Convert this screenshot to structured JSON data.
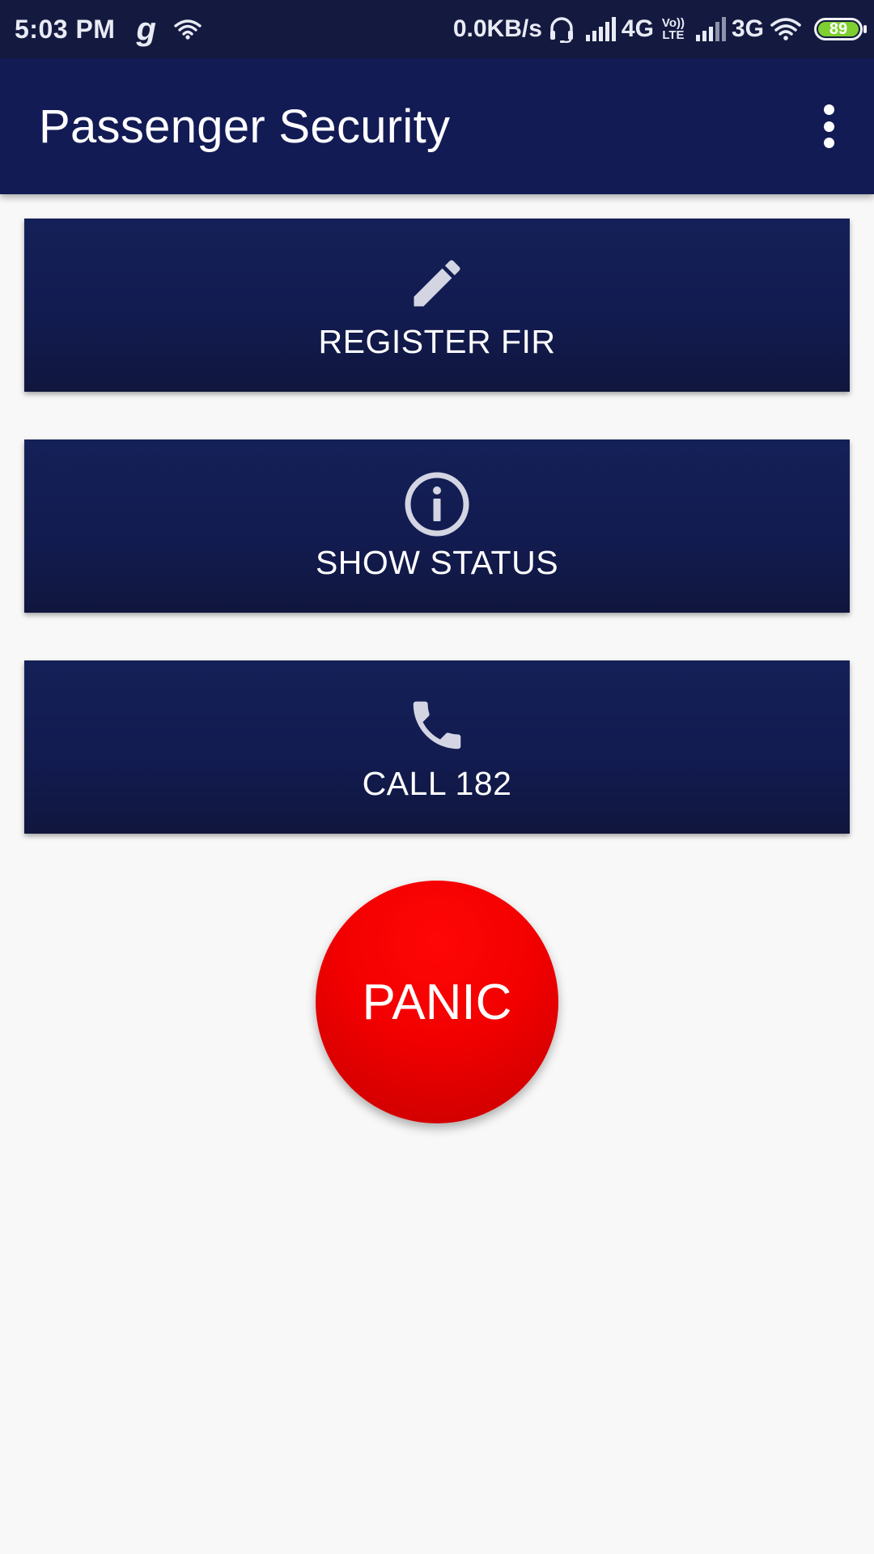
{
  "status_bar": {
    "time": "5:03 PM",
    "carrier_glyph": "g",
    "speed": "0.0KB/s",
    "network1": "4G",
    "volte_line1": "Vo))",
    "volte_line2": "LTE",
    "network2": "3G",
    "battery_level": "89",
    "icons": [
      "wifi-icon",
      "headset-icon",
      "signal-icon",
      "signal-icon",
      "wifi-icon",
      "battery-icon"
    ]
  },
  "app_bar": {
    "title": "Passenger Security",
    "menu_icon": "more-vert-icon"
  },
  "actions": [
    {
      "label": "REGISTER FIR",
      "icon": "pencil-icon"
    },
    {
      "label": "SHOW STATUS",
      "icon": "info-icon"
    },
    {
      "label": "CALL 182",
      "icon": "phone-icon"
    }
  ],
  "panic": {
    "label": "PANIC"
  },
  "colors": {
    "status_bar_bg": "#141a3f",
    "app_bar_bg": "#131b55",
    "card_bg": "#121b4f",
    "panic_red": "#f20000",
    "icon_tint": "#d3d5e3",
    "background": "#f8f8f8"
  }
}
